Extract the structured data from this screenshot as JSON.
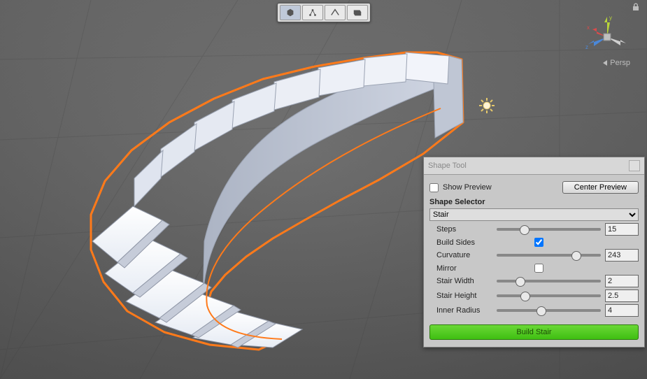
{
  "toolbar": {
    "modes": [
      "object",
      "vertex",
      "edge",
      "face"
    ],
    "active": 0
  },
  "persp_label": "Persp",
  "gizmo": {
    "x_label": "x",
    "y_label": "y",
    "z_label": "z",
    "x_color": "#d94b4b",
    "y_color": "#b8d33a",
    "z_color": "#4b88d9"
  },
  "panel": {
    "title": "Shape Tool",
    "show_preview": {
      "label": "Show Preview",
      "checked": false
    },
    "center_preview_label": "Center Preview",
    "section_label": "Shape Selector",
    "shape_select": {
      "value": "Stair"
    },
    "steps": {
      "label": "Steps",
      "value": "15",
      "pct": 22
    },
    "build_sides": {
      "label": "Build Sides",
      "checked": true
    },
    "curvature": {
      "label": "Curvature",
      "value": "243",
      "pct": 72
    },
    "mirror": {
      "label": "Mirror",
      "checked": false
    },
    "stair_width": {
      "label": "Stair Width",
      "value": "2",
      "pct": 18
    },
    "stair_height": {
      "label": "Stair Height",
      "value": "2.5",
      "pct": 23
    },
    "inner_radius": {
      "label": "Inner Radius",
      "value": "4",
      "pct": 38
    },
    "build_button": "Build Stair"
  }
}
